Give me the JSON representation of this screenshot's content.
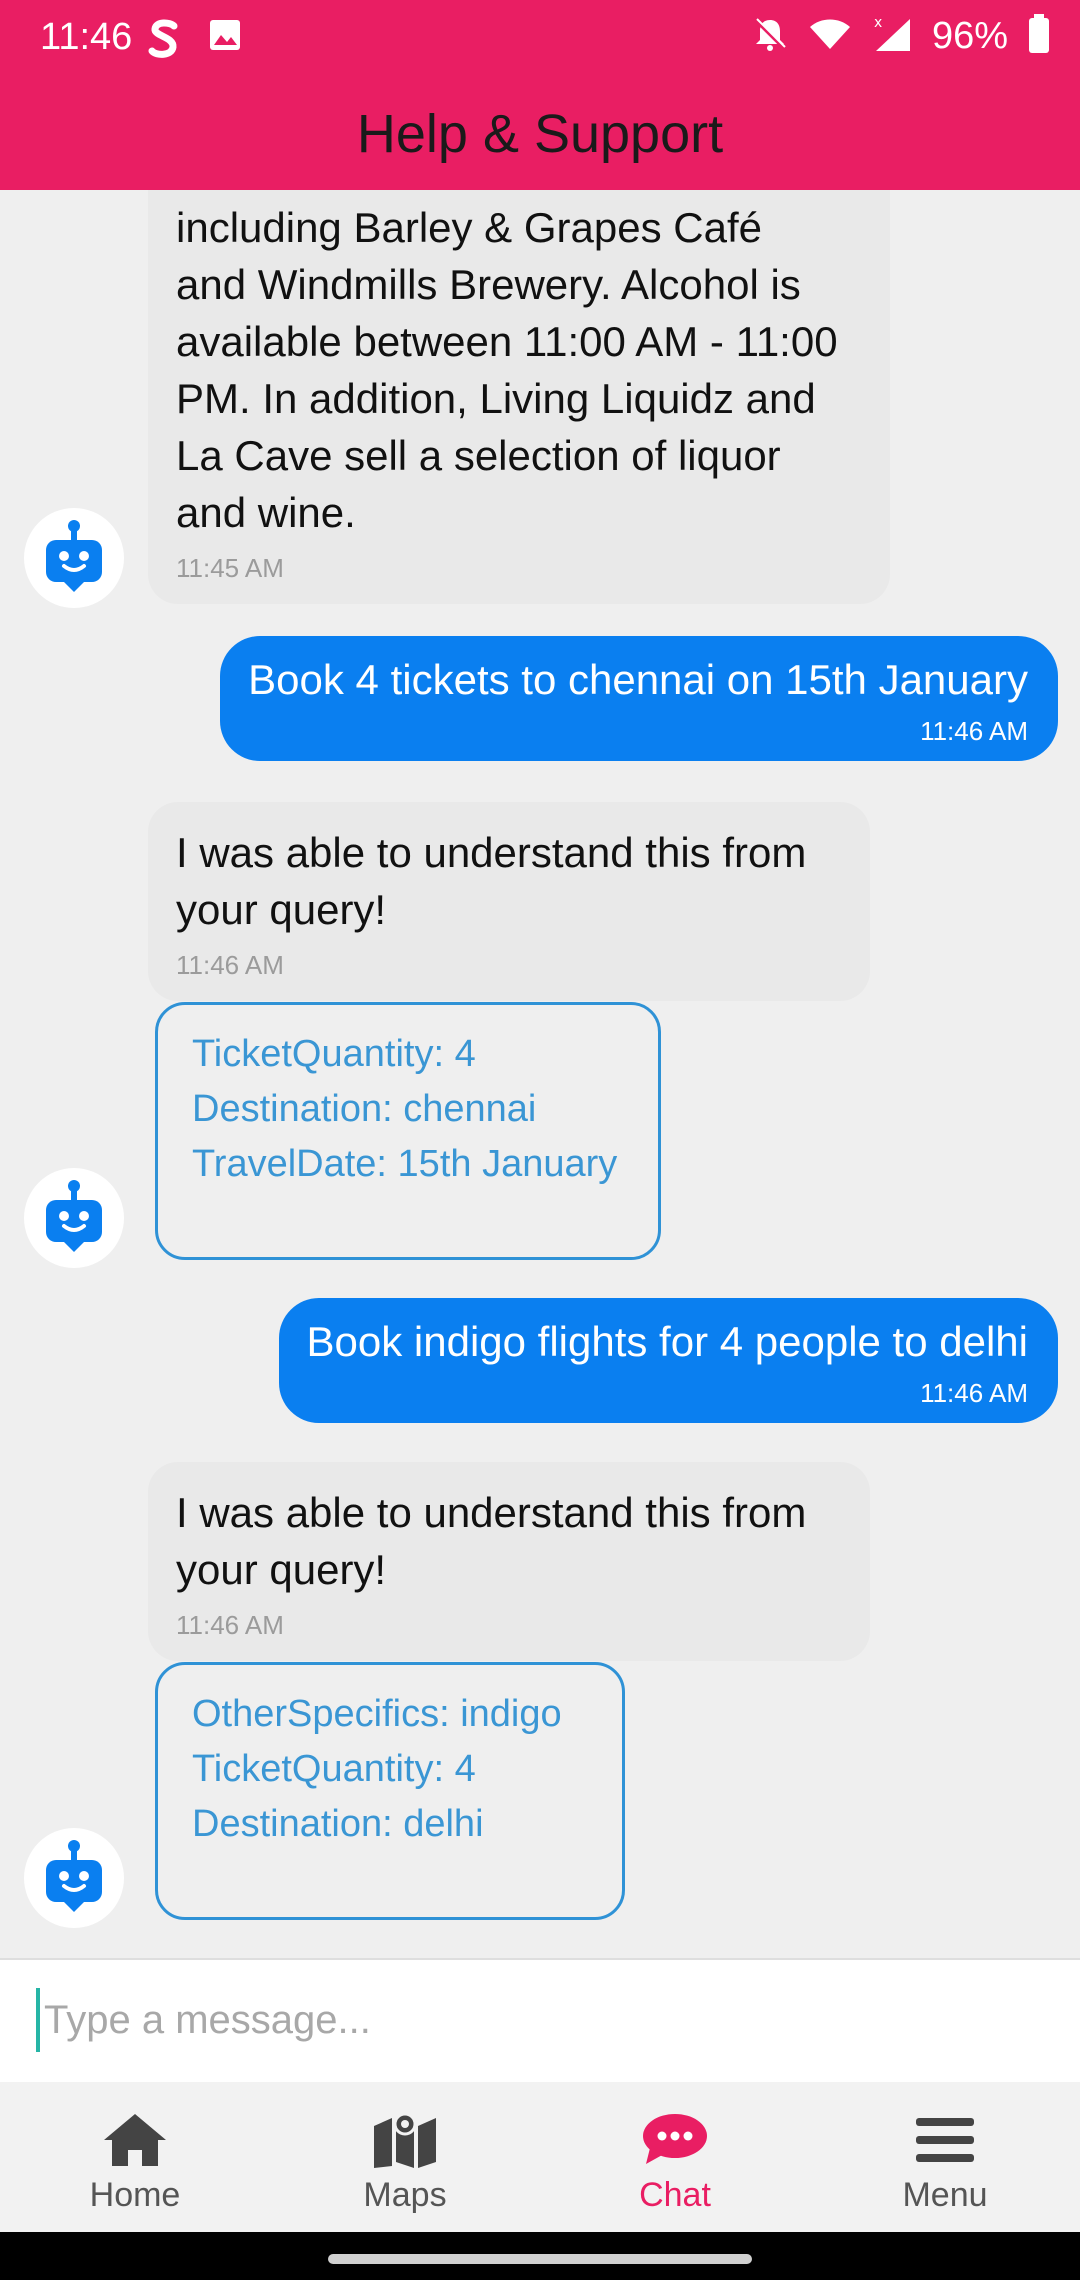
{
  "status_bar": {
    "time": "11:46",
    "battery": "96%",
    "left_icons": [
      "s-app-icon",
      "image-icon"
    ],
    "right_icons": [
      "bell-off-icon",
      "wifi-icon",
      "signal-icon",
      "battery-icon"
    ]
  },
  "header": {
    "title": "Help & Support"
  },
  "messages": [
    {
      "sender": "bot",
      "lines": [
        "including Barley & Grapes Café",
        "and Windmills Brewery. Alcohol is",
        "available between 11:00 AM - 11:00",
        "PM. In addition, Living Liquidz and",
        "La Cave sell a selection of liquor",
        "and wine."
      ],
      "time": "11:45 AM"
    },
    {
      "sender": "user",
      "text": "Book 4 tickets to chennai on 15th January",
      "time": "11:46 AM"
    },
    {
      "sender": "bot",
      "lines": [
        "I was able to understand this from",
        "your query!"
      ],
      "time": "11:46 AM"
    },
    {
      "sender": "card",
      "lines": [
        "TicketQuantity: 4",
        "Destination: chennai",
        "TravelDate: 15th January"
      ]
    },
    {
      "sender": "user",
      "text": "Book indigo flights for 4 people to delhi",
      "time": "11:46 AM"
    },
    {
      "sender": "bot",
      "lines": [
        "I was able to understand this from",
        "your query!"
      ],
      "time": "11:46 AM"
    },
    {
      "sender": "card",
      "lines": [
        "OtherSpecifics: indigo",
        "TicketQuantity: 4",
        "Destination: delhi"
      ]
    }
  ],
  "input": {
    "placeholder": "Type a message..."
  },
  "nav": {
    "items": [
      {
        "label": "Home",
        "icon": "home-icon",
        "active": false
      },
      {
        "label": "Maps",
        "icon": "map-icon",
        "active": false
      },
      {
        "label": "Chat",
        "icon": "chat-icon",
        "active": true
      },
      {
        "label": "Menu",
        "icon": "menu-icon",
        "active": false
      }
    ]
  },
  "colors": {
    "header": "#e91e63",
    "user_bubble": "#0a7ff0",
    "card_border": "#2f92d6",
    "card_text": "#3a96d4",
    "active_nav": "#e91e63"
  }
}
